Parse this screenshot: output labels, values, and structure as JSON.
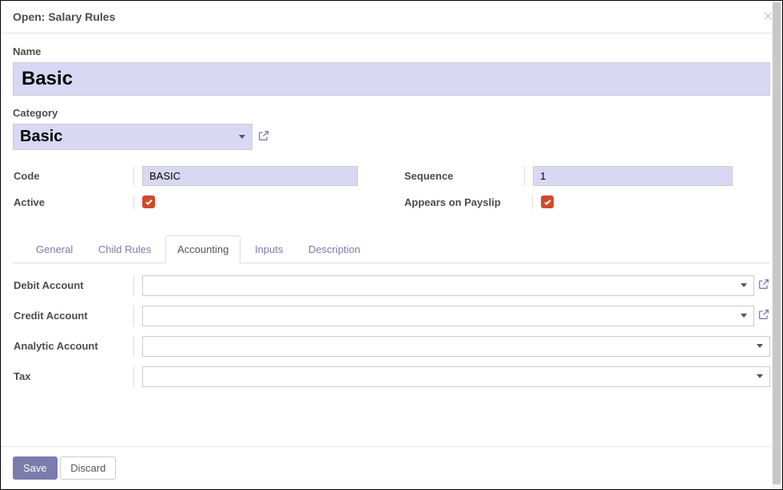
{
  "header": {
    "title": "Open: Salary Rules"
  },
  "form": {
    "name_label": "Name",
    "name_value": "Basic",
    "category_label": "Category",
    "category_value": "Basic",
    "code_label": "Code",
    "code_value": "BASIC",
    "sequence_label": "Sequence",
    "sequence_value": "1",
    "active_label": "Active",
    "active_checked": true,
    "appears_label": "Appears on Payslip",
    "appears_checked": true
  },
  "tabs": {
    "general": "General",
    "child_rules": "Child Rules",
    "accounting": "Accounting",
    "inputs": "Inputs",
    "description": "Description",
    "active": "accounting"
  },
  "accounting": {
    "debit_label": "Debit Account",
    "credit_label": "Credit Account",
    "analytic_label": "Analytic Account",
    "tax_label": "Tax"
  },
  "footer": {
    "save": "Save",
    "discard": "Discard"
  }
}
